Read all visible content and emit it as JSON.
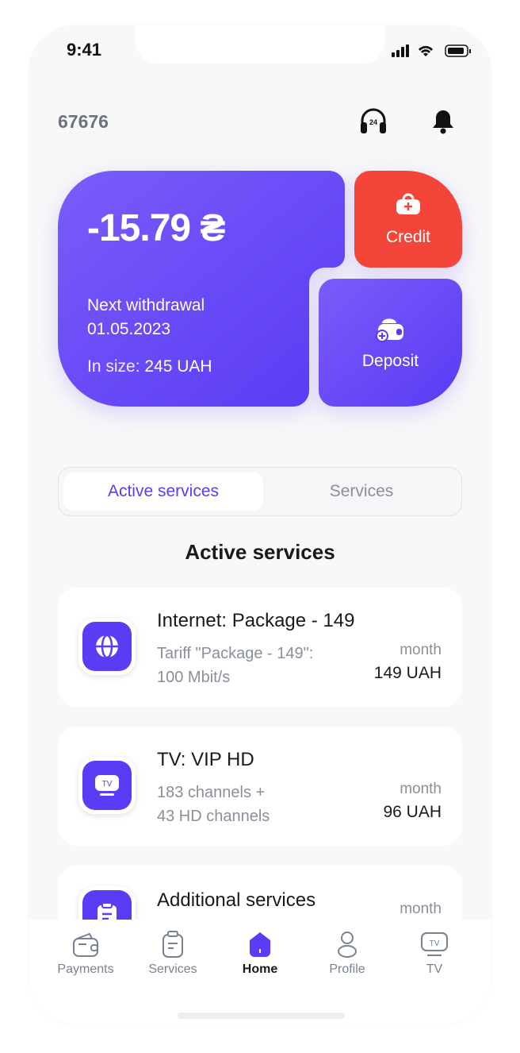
{
  "status": {
    "time": "9:41"
  },
  "header": {
    "account": "67676",
    "support_icon": "headset-24-icon",
    "bell_icon": "bell-icon"
  },
  "balance": {
    "amount": "-15.79 ₴",
    "next_label": "Next withdrawal",
    "next_date": "01.05.2023",
    "size_label": "In size: ",
    "size_value": "245 UAH"
  },
  "actions": {
    "credit": "Credit",
    "deposit": "Deposit"
  },
  "colors": {
    "accent": "#5b3cf5",
    "credit": "#f4453a",
    "muted": "#8a8f99"
  },
  "tabs": [
    {
      "label": "Active services",
      "active": true
    },
    {
      "label": "Services",
      "active": false
    }
  ],
  "section_title": "Active services",
  "services": [
    {
      "title": "Internet: Package - 149",
      "desc1": "Tariff \"Package - 149\":",
      "desc2": "100 Mbit/s",
      "period": "month",
      "price": "149 UAH",
      "icon": "globe-icon"
    },
    {
      "title": "TV: VIP HD",
      "desc1": "183 channels +",
      "desc2": "43 HD channels",
      "period": "month",
      "price": "96 UAH",
      "icon": "tv-icon"
    },
    {
      "title": "Additional services",
      "period": "month",
      "icon": "clipboard-icon"
    }
  ],
  "nav": [
    {
      "label": "Payments"
    },
    {
      "label": "Services"
    },
    {
      "label": "Home",
      "active": true
    },
    {
      "label": "Profile"
    },
    {
      "label": "TV"
    }
  ]
}
